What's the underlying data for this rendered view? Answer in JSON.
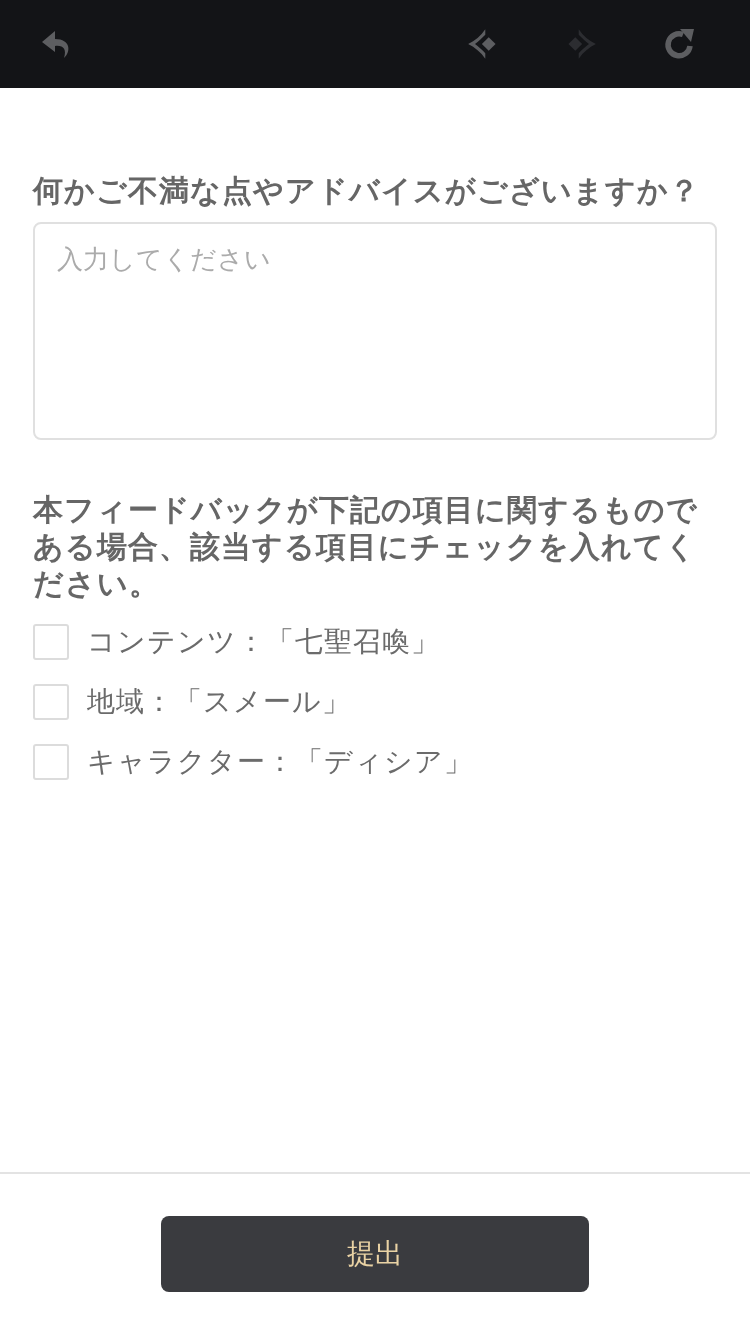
{
  "toolbar": {
    "buttons": [
      {
        "kind": "back",
        "disabled": false
      },
      {
        "kind": "previous",
        "disabled": false
      },
      {
        "kind": "next",
        "disabled": true
      },
      {
        "kind": "reload",
        "disabled": false
      }
    ]
  },
  "question": {
    "label": "何かご不満な点やアドバイスがございますか？",
    "placeholder": "入力してください"
  },
  "topics": {
    "label": "本フィードバックが下記の項目に関するものである場合、該当する項目にチェックを入れてください。",
    "options": [
      {
        "text": "コンテンツ：「七聖召喚」",
        "checked": false
      },
      {
        "text": "地域：「スメール」",
        "checked": false
      },
      {
        "text": "キャラクター：「ディシア」",
        "checked": false
      }
    ]
  },
  "submit": {
    "label": "提出"
  }
}
